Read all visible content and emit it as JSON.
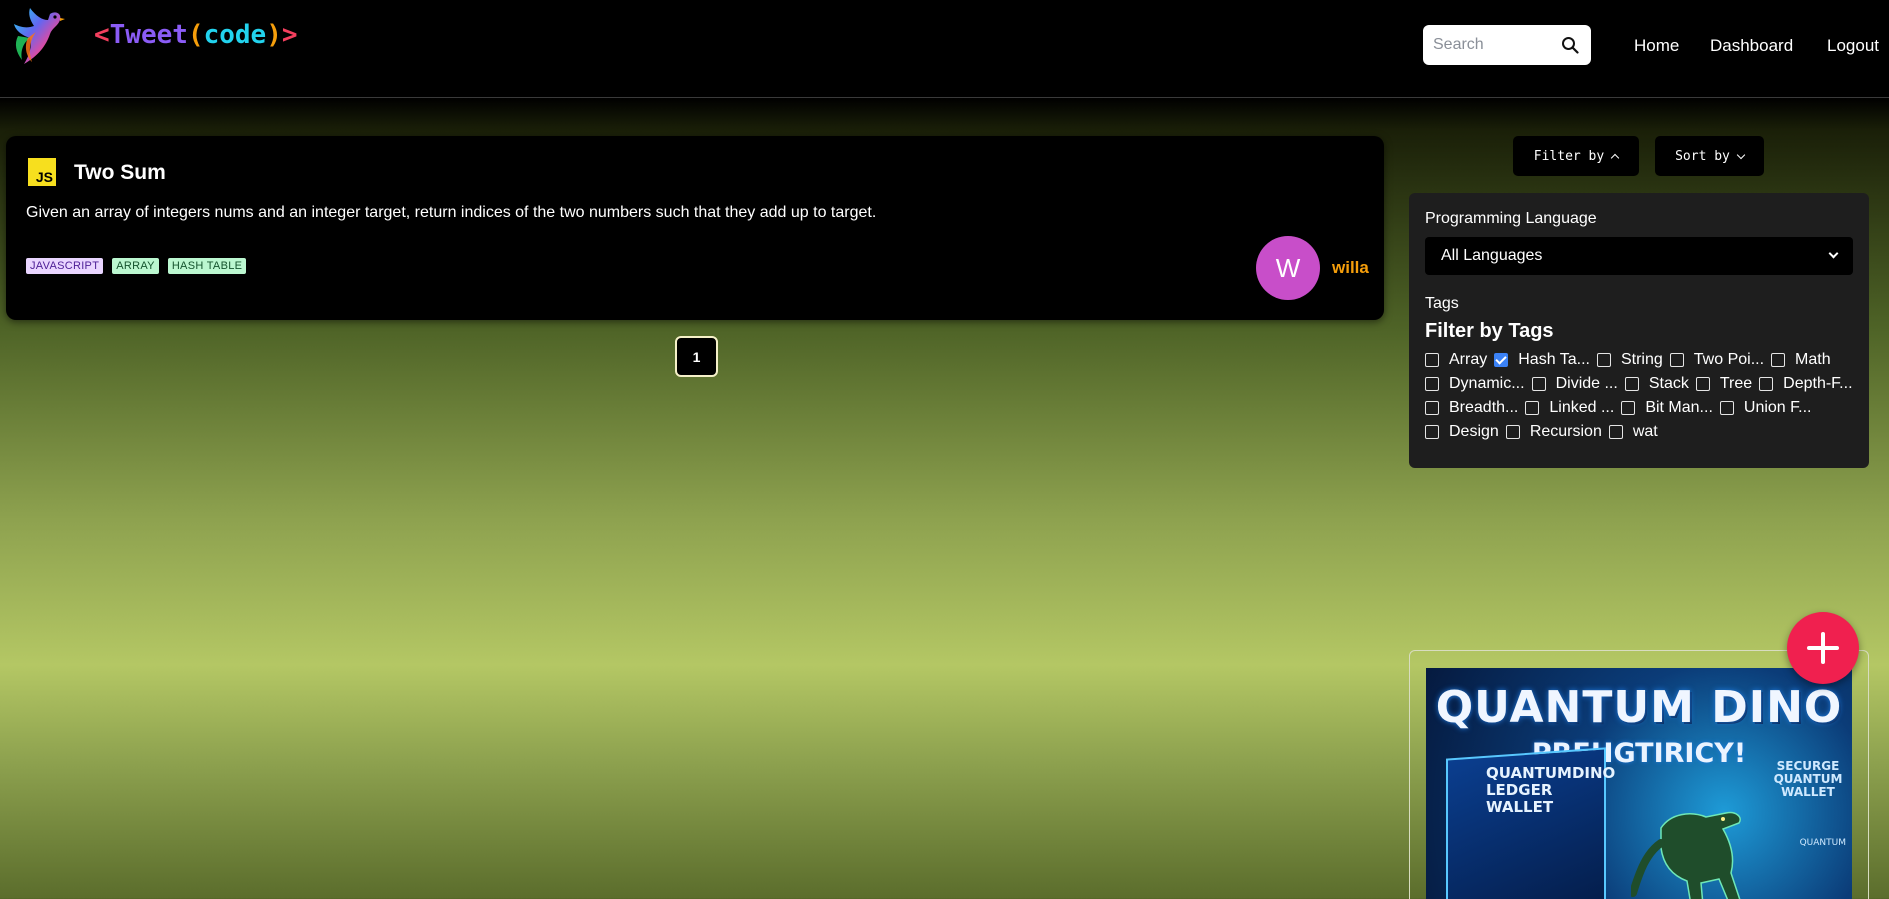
{
  "header": {
    "brand": {
      "lt": "<",
      "name": "Tweet",
      "paren_open": "(",
      "code": "code",
      "paren_close": ")",
      "gt": ">"
    },
    "search": {
      "placeholder": "Search"
    },
    "nav": {
      "home": "Home",
      "dashboard": "Dashboard",
      "logout": "Logout"
    }
  },
  "post": {
    "lang_badge": "JS",
    "title": "Two Sum",
    "description": "Given an array of integers nums and an integer target, return indices of the two numbers such that they add up to target.",
    "tags": [
      "JAVASCRIPT",
      "ARRAY",
      "HASH TABLE"
    ],
    "avatar_letter": "W",
    "author": "willa"
  },
  "pagination": {
    "current": "1"
  },
  "controls": {
    "filter_label": "Filter by",
    "sort_label": "Sort by"
  },
  "filter_panel": {
    "language_label": "Programming Language",
    "language_value": "All Languages",
    "tags_label": "Tags",
    "tags_heading": "Filter by Tags",
    "tag_rows": [
      [
        {
          "label": "Array",
          "checked": false
        },
        {
          "label": "Hash Ta...",
          "checked": true
        },
        {
          "label": "String",
          "checked": false
        },
        {
          "label": "Two Poi...",
          "checked": false
        },
        {
          "label": "Math",
          "checked": false
        }
      ],
      [
        {
          "label": "Dynamic...",
          "checked": false
        },
        {
          "label": "Divide ...",
          "checked": false
        },
        {
          "label": "Stack",
          "checked": false
        },
        {
          "label": "Tree",
          "checked": false
        },
        {
          "label": "Depth-F...",
          "checked": false
        }
      ],
      [
        {
          "label": "Breadth...",
          "checked": false
        },
        {
          "label": "Linked ...",
          "checked": false
        },
        {
          "label": "Bit Man...",
          "checked": false
        },
        {
          "label": "Union F...",
          "checked": false
        }
      ],
      [
        {
          "label": "Design",
          "checked": false
        },
        {
          "label": "Recursion",
          "checked": false
        },
        {
          "label": "wat",
          "checked": false
        }
      ]
    ]
  },
  "ad": {
    "title_line1": "QUANTUM DINO",
    "title_line2": "PREHGTIRICY!",
    "box_text": "QUANTUMDINO LEDGER WALLET",
    "side_text": "SECURGE QUANTUM WALLET",
    "small_text": "QUANTUM"
  },
  "colors": {
    "accent_pink": "#f0204f",
    "author_orange": "#f59e0b",
    "avatar_bg": "#c84ec9",
    "checkbox_blue": "#3b82f6"
  }
}
